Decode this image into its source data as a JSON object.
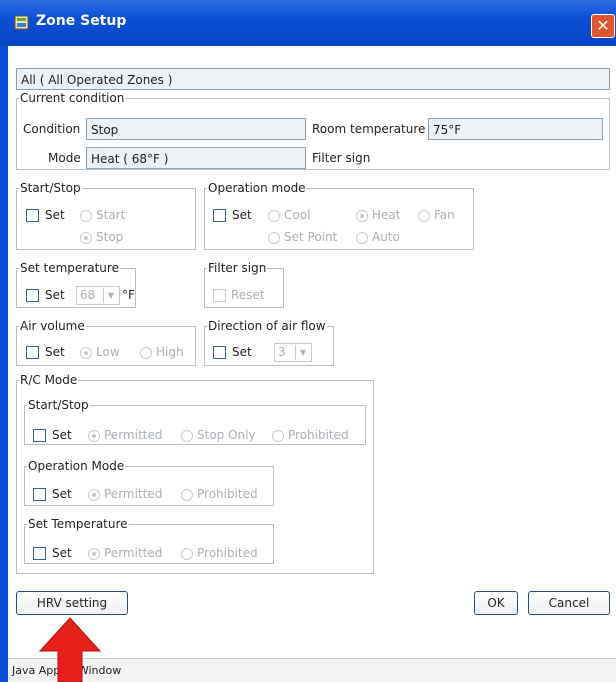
{
  "window": {
    "title": "Zone Setup",
    "close_label": "✕",
    "status_text": "Java Applet Window"
  },
  "zone_field": "All ( All Operated Zones )",
  "current_condition": {
    "legend": "Current condition",
    "condition_label": "Condition",
    "condition_value": "Stop",
    "room_temp_label": "Room temperature",
    "room_temp_value": "75°F",
    "mode_label": "Mode",
    "mode_value": "Heat ( 68°F )",
    "filter_sign_label": "Filter sign"
  },
  "start_stop": {
    "legend": "Start/Stop",
    "set_label": "Set",
    "options": [
      "Start",
      "Stop"
    ],
    "selected": "Stop"
  },
  "operation_mode": {
    "legend": "Operation mode",
    "set_label": "Set",
    "options": [
      "Cool",
      "Heat",
      "Fan",
      "Set Point",
      "Auto"
    ],
    "selected": "Heat"
  },
  "set_temperature": {
    "legend": "Set temperature",
    "set_label": "Set",
    "value": "68",
    "unit": "°F"
  },
  "filter_sign": {
    "legend": "Filter sign",
    "reset_label": "Reset"
  },
  "air_volume": {
    "legend": "Air volume",
    "set_label": "Set",
    "options": [
      "Low",
      "High"
    ],
    "selected": "Low"
  },
  "air_flow": {
    "legend": "Direction of air flow",
    "set_label": "Set",
    "value": "3"
  },
  "rc_mode": {
    "legend": "R/C Mode",
    "start_stop": {
      "legend": "Start/Stop",
      "set_label": "Set",
      "options": [
        "Permitted",
        "Stop Only",
        "Prohibited"
      ],
      "selected": "Permitted"
    },
    "operation_mode": {
      "legend": "Operation Mode",
      "set_label": "Set",
      "options": [
        "Permitted",
        "Prohibited"
      ],
      "selected": "Permitted"
    },
    "set_temperature": {
      "legend": "Set Temperature",
      "set_label": "Set",
      "options": [
        "Permitted",
        "Prohibited"
      ],
      "selected": "Permitted"
    }
  },
  "buttons": {
    "hrv": "HRV setting",
    "ok": "OK",
    "cancel": "Cancel"
  },
  "colors": {
    "titlebar": "#0a4fd8",
    "close_button": "#e0562c",
    "annotation_arrow": "#e8201c"
  },
  "icons": [
    "app-icon",
    "close-icon",
    "dropdown-arrow-icon",
    "annotation-arrow-icon"
  ]
}
